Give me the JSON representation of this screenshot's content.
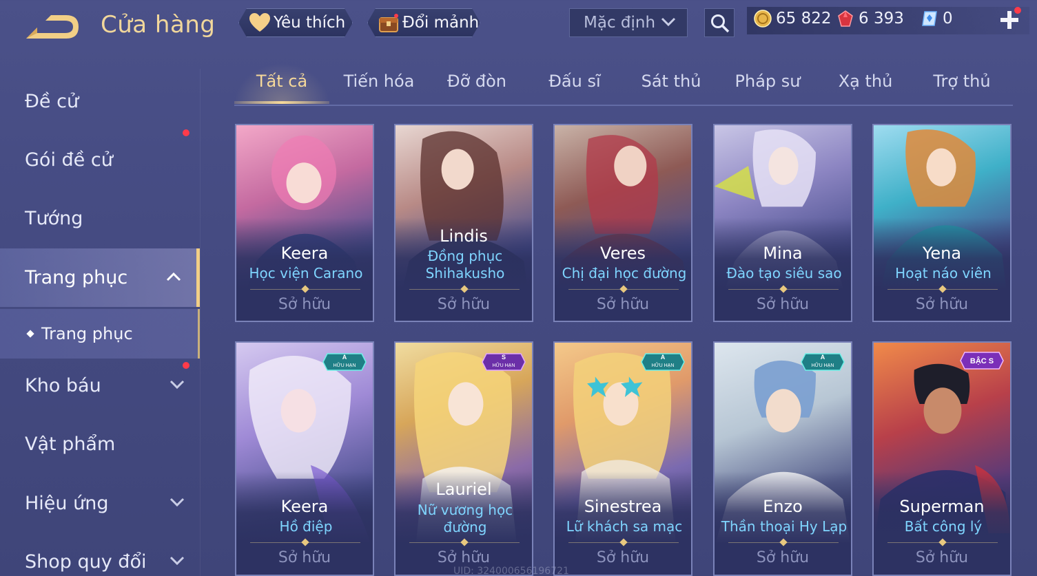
{
  "header": {
    "title": "Cửa hàng",
    "favorite_label": "Yêu thích",
    "swap_label": "Đổi mảnh",
    "sort_value": "Mặc định",
    "currencies": {
      "gold": "65 822",
      "ruby": "6 393",
      "diamond": "0"
    }
  },
  "sidebar": {
    "items": [
      {
        "label": "Đề cử"
      },
      {
        "label": "Gói đề cử"
      },
      {
        "label": "Tướng"
      },
      {
        "label": "Trang phục"
      },
      {
        "label": "Kho báu"
      },
      {
        "label": "Vật phẩm"
      },
      {
        "label": "Hiệu ứng"
      },
      {
        "label": "Shop quy đổi"
      }
    ],
    "sub_label": "Trang phục"
  },
  "tabs": [
    "Tất cả",
    "Tiến hóa",
    "Đỡ đòn",
    "Đấu sĩ",
    "Sát thủ",
    "Pháp sư",
    "Xạ thủ",
    "Trợ thủ"
  ],
  "cards": [
    {
      "hero": "Keera",
      "skin": "Học viện Carano",
      "status": "Sở hữu"
    },
    {
      "hero": "Lindis",
      "skin": "Đồng phục Shihakusho",
      "status": "Sở hữu"
    },
    {
      "hero": "Veres",
      "skin": "Chị đại học đường",
      "status": "Sở hữu"
    },
    {
      "hero": "Mina",
      "skin": "Đào tạo siêu sao",
      "status": "Sở hữu"
    },
    {
      "hero": "Yena",
      "skin": "Hoạt náo viên",
      "status": "Sở hữu"
    },
    {
      "hero": "Keera",
      "skin": "Hồ điệp",
      "status": "Sở hữu",
      "badge_rank": "A",
      "badge_text": "HỮU HẠN"
    },
    {
      "hero": "Lauriel",
      "skin": "Nữ vương học đường",
      "status": "Sở hữu",
      "badge_rank": "S",
      "badge_text": "HỮU HẠN"
    },
    {
      "hero": "Sinestrea",
      "skin": "Lữ khách sa mạc",
      "status": "Sở hữu",
      "badge_rank": "A",
      "badge_text": "HỮU HẠN"
    },
    {
      "hero": "Enzo",
      "skin": "Thần thoại Hy Lạp",
      "status": "Sở hữu",
      "badge_rank": "A",
      "badge_text": "HỮU HẠN"
    },
    {
      "hero": "Superman",
      "skin": "Bất công lý",
      "status": "Sở hữu",
      "badge_text": "BẬC S"
    }
  ],
  "uid": "UID: 324000656196721",
  "colors": {
    "accent_gold": "#f1d79b",
    "skin_name_blue": "#7fd5ff",
    "notification_red": "#ff3b4a"
  }
}
